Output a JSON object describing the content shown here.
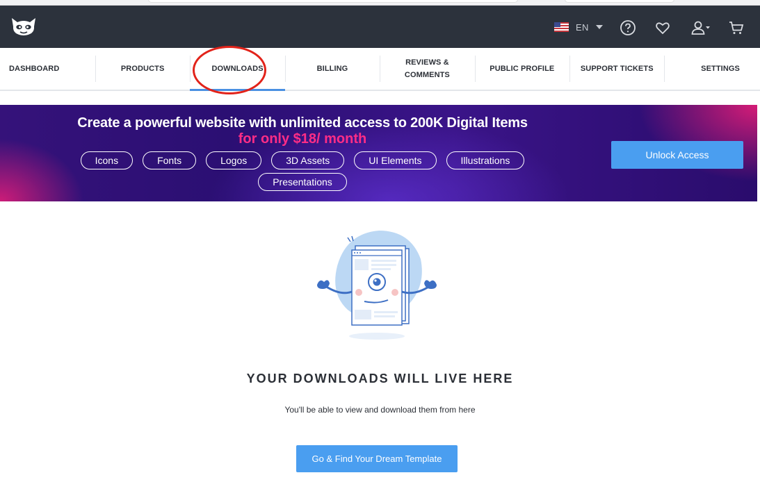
{
  "header": {
    "language": "EN",
    "icons": [
      "help-icon",
      "heart-icon",
      "user-icon",
      "cart-icon"
    ]
  },
  "tabs": [
    {
      "label": "DASHBOARD",
      "active": false
    },
    {
      "label": "PRODUCTS",
      "active": false
    },
    {
      "label": "DOWNLOADS",
      "active": true
    },
    {
      "label": "BILLING",
      "active": false
    },
    {
      "label": "REVIEWS & COMMENTS",
      "active": false
    },
    {
      "label": "PUBLIC PROFILE",
      "active": false
    },
    {
      "label": "SUPPORT TICKETS",
      "active": false
    },
    {
      "label": "SETTINGS",
      "active": false
    }
  ],
  "banner": {
    "title": "Create a powerful website with unlimited access to 200K Digital Items",
    "subtitle": "for only $18/ month",
    "chips": [
      "Icons",
      "Fonts",
      "Logos",
      "3D Assets",
      "UI Elements",
      "Illustrations",
      "Presentations"
    ],
    "button": "Unlock Access"
  },
  "empty_state": {
    "title": "YOUR DOWNLOADS WILL LIVE HERE",
    "description": "You'll be able to view and download them from here",
    "button": "Go & Find Your Dream Template"
  },
  "colors": {
    "header_bg": "#2c323c",
    "accent_blue": "#4a9ef0",
    "active_tab_underline": "#4a90e2",
    "banner_pink": "#ff2d86",
    "annotation_ring": "#e2231a"
  }
}
